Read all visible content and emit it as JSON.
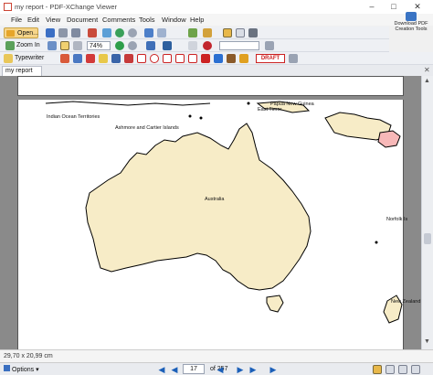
{
  "window": {
    "title": "my report - PDF-XChange Viewer"
  },
  "menu": [
    "File",
    "Edit",
    "View",
    "Document",
    "Comments",
    "Tools",
    "Window",
    "Help"
  ],
  "download_promo": {
    "line1": "Download PDF",
    "line2": "Creation Tools"
  },
  "toolbar1": {
    "open_label": "Open..."
  },
  "toolbar2": {
    "zoom_label": "Zoom In",
    "zoom_value": "74%"
  },
  "toolbar3": {
    "typewriter_label": "Typewriter",
    "stamp_label": "DRAFT"
  },
  "tabs": [
    {
      "label": "my report"
    }
  ],
  "map": {
    "labels": {
      "indian_ocean": "Indian Ocean Territories",
      "ashmore": "Ashmore and Cartier Islands",
      "east_timor": "East Timor",
      "png": "Papua New Guinea",
      "australia": "Australia",
      "norfolk": "Norfolk Is",
      "nz": "New Zealand"
    },
    "colors": {
      "land": "#f7ecc7",
      "highlight": "#f7b8b8",
      "stroke": "#000000"
    }
  },
  "status": {
    "page_size": "29,70 x 20,99 cm"
  },
  "navigation": {
    "options_label": "Options",
    "current_page": "17",
    "total_pages": "of 257"
  }
}
